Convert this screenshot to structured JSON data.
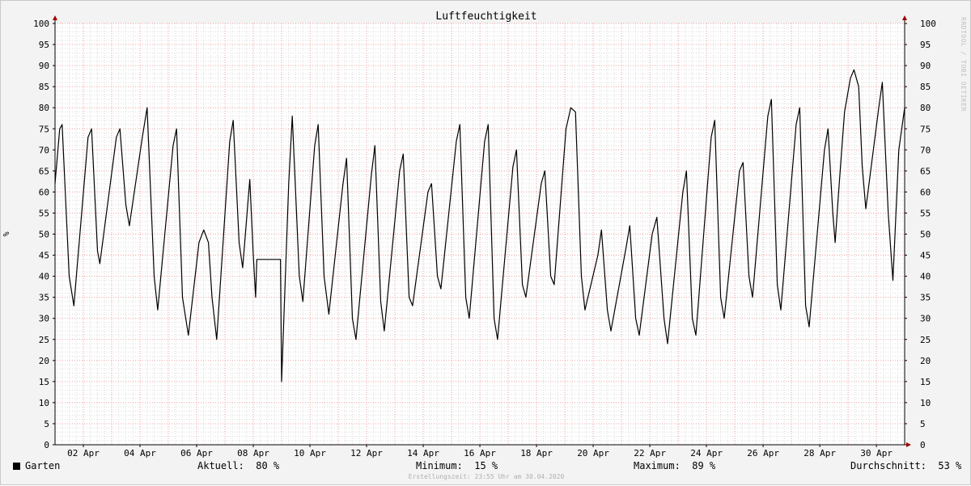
{
  "chart_data": {
    "type": "line",
    "title": "Luftfeuchtigkeit",
    "ylabel": "%",
    "ylim": [
      0,
      100
    ],
    "yticks": [
      0,
      5,
      10,
      15,
      20,
      25,
      30,
      35,
      40,
      45,
      50,
      55,
      60,
      65,
      70,
      75,
      80,
      85,
      90,
      95,
      100
    ],
    "xlim": [
      "2020-04-01 00:00",
      "2020-04-30 23:55"
    ],
    "xticks": [
      {
        "date": "2020-04-02",
        "label": "02 Apr"
      },
      {
        "date": "2020-04-04",
        "label": "04 Apr"
      },
      {
        "date": "2020-04-06",
        "label": "06 Apr"
      },
      {
        "date": "2020-04-08",
        "label": "08 Apr"
      },
      {
        "date": "2020-04-10",
        "label": "10 Apr"
      },
      {
        "date": "2020-04-12",
        "label": "12 Apr"
      },
      {
        "date": "2020-04-14",
        "label": "14 Apr"
      },
      {
        "date": "2020-04-16",
        "label": "16 Apr"
      },
      {
        "date": "2020-04-18",
        "label": "18 Apr"
      },
      {
        "date": "2020-04-20",
        "label": "20 Apr"
      },
      {
        "date": "2020-04-22",
        "label": "22 Apr"
      },
      {
        "date": "2020-04-24",
        "label": "24 Apr"
      },
      {
        "date": "2020-04-26",
        "label": "26 Apr"
      },
      {
        "date": "2020-04-28",
        "label": "28 Apr"
      },
      {
        "date": "2020-04-30",
        "label": "30 Apr"
      }
    ],
    "grid": true,
    "series": [
      {
        "name": "Garten",
        "color": "#000000",
        "points": [
          [
            "2020-04-01 00:00",
            62
          ],
          [
            "2020-04-01 04:00",
            75
          ],
          [
            "2020-04-01 06:00",
            76
          ],
          [
            "2020-04-01 12:00",
            40
          ],
          [
            "2020-04-01 16:00",
            33
          ],
          [
            "2020-04-02 04:00",
            73
          ],
          [
            "2020-04-02 07:00",
            75
          ],
          [
            "2020-04-02 12:00",
            46
          ],
          [
            "2020-04-02 14:00",
            43
          ],
          [
            "2020-04-03 04:00",
            73
          ],
          [
            "2020-04-03 07:00",
            75
          ],
          [
            "2020-04-03 12:00",
            57
          ],
          [
            "2020-04-03 15:00",
            52
          ],
          [
            "2020-04-04 02:00",
            73
          ],
          [
            "2020-04-04 06:00",
            80
          ],
          [
            "2020-04-04 12:00",
            40
          ],
          [
            "2020-04-04 15:00",
            32
          ],
          [
            "2020-04-05 04:00",
            71
          ],
          [
            "2020-04-05 07:00",
            75
          ],
          [
            "2020-04-05 12:00",
            35
          ],
          [
            "2020-04-05 17:00",
            26
          ],
          [
            "2020-04-06 02:00",
            48
          ],
          [
            "2020-04-06 06:00",
            51
          ],
          [
            "2020-04-06 10:00",
            48
          ],
          [
            "2020-04-06 13:00",
            35
          ],
          [
            "2020-04-06 17:00",
            25
          ],
          [
            "2020-04-07 04:00",
            72
          ],
          [
            "2020-04-07 07:00",
            77
          ],
          [
            "2020-04-07 12:00",
            48
          ],
          [
            "2020-04-07 15:00",
            42
          ],
          [
            "2020-04-07 21:00",
            63
          ],
          [
            "2020-04-08 00:00",
            45
          ],
          [
            "2020-04-08 02:00",
            35
          ],
          [
            "2020-04-08 03:00",
            44
          ],
          [
            "2020-04-08 23:00",
            44
          ],
          [
            "2020-04-09 00:00",
            15
          ],
          [
            "2020-04-09 06:00",
            62
          ],
          [
            "2020-04-09 09:00",
            78
          ],
          [
            "2020-04-09 15:00",
            40
          ],
          [
            "2020-04-09 18:00",
            34
          ],
          [
            "2020-04-10 04:00",
            71
          ],
          [
            "2020-04-10 07:00",
            76
          ],
          [
            "2020-04-10 12:00",
            40
          ],
          [
            "2020-04-10 16:00",
            31
          ],
          [
            "2020-04-11 04:00",
            62
          ],
          [
            "2020-04-11 07:00",
            68
          ],
          [
            "2020-04-11 12:00",
            30
          ],
          [
            "2020-04-11 15:00",
            25
          ],
          [
            "2020-04-12 04:00",
            64
          ],
          [
            "2020-04-12 07:00",
            71
          ],
          [
            "2020-04-12 12:00",
            34
          ],
          [
            "2020-04-12 15:00",
            27
          ],
          [
            "2020-04-13 04:00",
            65
          ],
          [
            "2020-04-13 07:00",
            69
          ],
          [
            "2020-04-13 12:00",
            35
          ],
          [
            "2020-04-13 15:00",
            33
          ],
          [
            "2020-04-14 04:00",
            60
          ],
          [
            "2020-04-14 07:00",
            62
          ],
          [
            "2020-04-14 12:00",
            40
          ],
          [
            "2020-04-14 15:00",
            37
          ],
          [
            "2020-04-15 04:00",
            72
          ],
          [
            "2020-04-15 07:00",
            76
          ],
          [
            "2020-04-15 12:00",
            35
          ],
          [
            "2020-04-15 15:00",
            30
          ],
          [
            "2020-04-16 04:00",
            72
          ],
          [
            "2020-04-16 07:00",
            76
          ],
          [
            "2020-04-16 12:00",
            30
          ],
          [
            "2020-04-16 15:00",
            25
          ],
          [
            "2020-04-17 04:00",
            66
          ],
          [
            "2020-04-17 07:00",
            70
          ],
          [
            "2020-04-17 12:00",
            38
          ],
          [
            "2020-04-17 15:00",
            35
          ],
          [
            "2020-04-18 04:00",
            62
          ],
          [
            "2020-04-18 07:00",
            65
          ],
          [
            "2020-04-18 12:00",
            40
          ],
          [
            "2020-04-18 15:00",
            38
          ],
          [
            "2020-04-19 01:00",
            75
          ],
          [
            "2020-04-19 05:00",
            80
          ],
          [
            "2020-04-19 09:00",
            79
          ],
          [
            "2020-04-19 14:00",
            40
          ],
          [
            "2020-04-19 17:00",
            32
          ],
          [
            "2020-04-20 04:00",
            45
          ],
          [
            "2020-04-20 07:00",
            51
          ],
          [
            "2020-04-20 12:00",
            32
          ],
          [
            "2020-04-20 15:00",
            27
          ],
          [
            "2020-04-21 04:00",
            47
          ],
          [
            "2020-04-21 07:00",
            52
          ],
          [
            "2020-04-21 12:00",
            30
          ],
          [
            "2020-04-21 15:00",
            26
          ],
          [
            "2020-04-22 02:00",
            50
          ],
          [
            "2020-04-22 06:00",
            54
          ],
          [
            "2020-04-22 12:00",
            30
          ],
          [
            "2020-04-22 15:00",
            24
          ],
          [
            "2020-04-23 04:00",
            60
          ],
          [
            "2020-04-23 07:00",
            65
          ],
          [
            "2020-04-23 12:00",
            30
          ],
          [
            "2020-04-23 15:00",
            26
          ],
          [
            "2020-04-24 04:00",
            73
          ],
          [
            "2020-04-24 07:00",
            77
          ],
          [
            "2020-04-24 12:00",
            35
          ],
          [
            "2020-04-24 15:00",
            30
          ],
          [
            "2020-04-25 04:00",
            65
          ],
          [
            "2020-04-25 07:00",
            67
          ],
          [
            "2020-04-25 12:00",
            40
          ],
          [
            "2020-04-25 15:00",
            35
          ],
          [
            "2020-04-26 04:00",
            78
          ],
          [
            "2020-04-26 07:00",
            82
          ],
          [
            "2020-04-26 12:00",
            38
          ],
          [
            "2020-04-26 15:00",
            32
          ],
          [
            "2020-04-27 04:00",
            76
          ],
          [
            "2020-04-27 07:00",
            80
          ],
          [
            "2020-04-27 12:00",
            33
          ],
          [
            "2020-04-27 15:00",
            28
          ],
          [
            "2020-04-28 04:00",
            70
          ],
          [
            "2020-04-28 07:00",
            75
          ],
          [
            "2020-04-28 11:00",
            55
          ],
          [
            "2020-04-28 13:00",
            48
          ],
          [
            "2020-04-28 16:00",
            60
          ],
          [
            "2020-04-28 21:00",
            79
          ],
          [
            "2020-04-29 02:00",
            87
          ],
          [
            "2020-04-29 05:00",
            89
          ],
          [
            "2020-04-29 09:00",
            85
          ],
          [
            "2020-04-29 12:00",
            66
          ],
          [
            "2020-04-29 15:00",
            56
          ],
          [
            "2020-04-30 02:00",
            80
          ],
          [
            "2020-04-30 05:00",
            86
          ],
          [
            "2020-04-30 10:00",
            55
          ],
          [
            "2020-04-30 14:00",
            39
          ],
          [
            "2020-04-30 19:00",
            70
          ],
          [
            "2020-04-30 23:55",
            80
          ]
        ]
      }
    ]
  },
  "legend": {
    "series_label": "Garten",
    "current_label": "Aktuell:",
    "current_value": "80 %",
    "min_label": "Minimum:",
    "min_value": "15 %",
    "max_label": "Maximum:",
    "max_value": "89 %",
    "avg_label": "Durchschnitt:",
    "avg_value": "53 %"
  },
  "footer": "Erstellungszeit: 23:55 Uhr am 30.04.2020",
  "watermark": "RRDTOOL / TOBI OETIKER",
  "colors": {
    "background": "#f3f3f3",
    "plot_background": "#ffffff",
    "major_grid": "#f0a0a0",
    "minor_grid": "#dcdcdc",
    "axis_arrow": "#a00000",
    "line": "#000000"
  }
}
